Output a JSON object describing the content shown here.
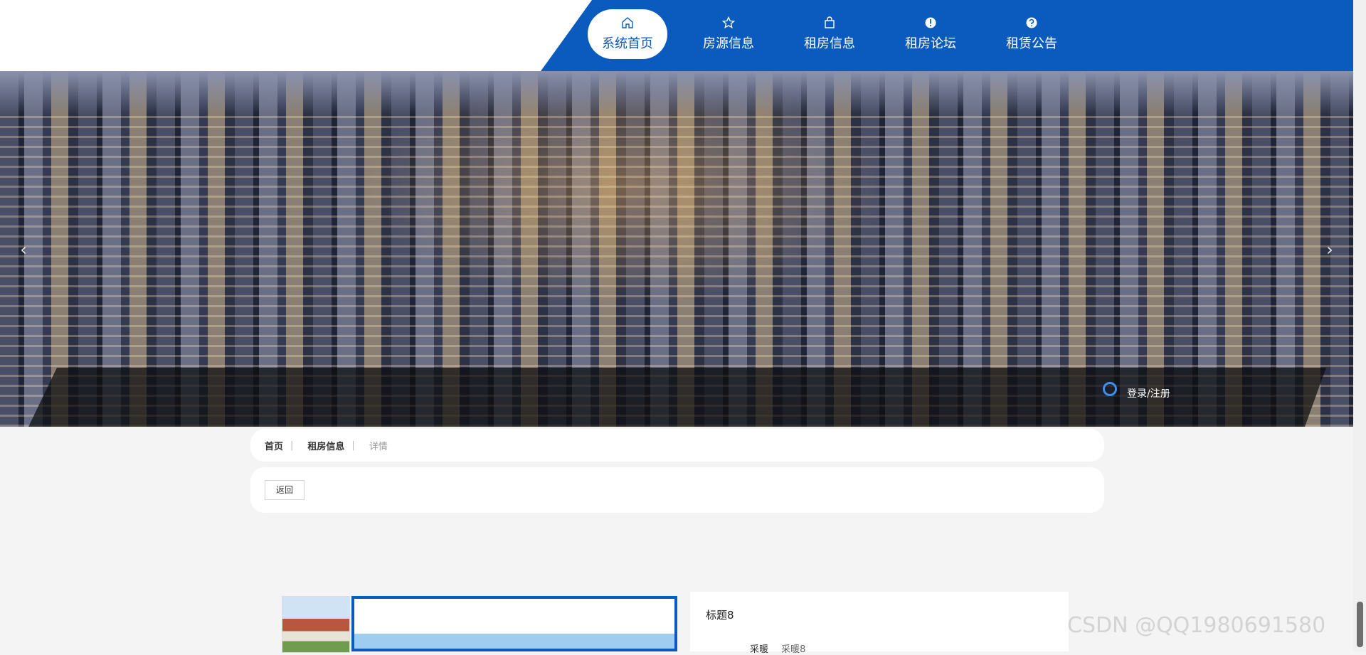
{
  "nav": {
    "items": [
      {
        "label": "系统首页",
        "icon": "home-icon",
        "active": true
      },
      {
        "label": "房源信息",
        "icon": "star-icon",
        "active": false
      },
      {
        "label": "租房信息",
        "icon": "bag-icon",
        "active": false
      },
      {
        "label": "租房论坛",
        "icon": "alert-icon",
        "active": false
      },
      {
        "label": "租赁公告",
        "icon": "help-icon",
        "active": false
      }
    ]
  },
  "hero": {
    "prev_arrow": "‹",
    "next_arrow": "›",
    "login_label": "登录/注册"
  },
  "breadcrumb": {
    "home": "首页",
    "section": "租房信息",
    "current": "详情",
    "separator": "|"
  },
  "actions": {
    "back_label": "返回"
  },
  "detail": {
    "title": "标题8",
    "row_label": "采暖",
    "row_value": "采暖8"
  },
  "watermark": "CSDN @QQ1980691580",
  "colors": {
    "brand": "#0a5bbd"
  }
}
